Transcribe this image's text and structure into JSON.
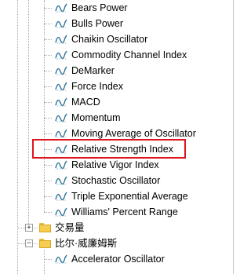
{
  "indicators": [
    "Bears Power",
    "Bulls Power",
    "Chaikin Oscillator",
    "Commodity Channel Index",
    "DeMarker",
    "Force Index",
    "MACD",
    "Momentum",
    "Moving Average of Oscillator",
    "Relative Strength Index",
    "Relative Vigor Index",
    "Stochastic Oscillator",
    "Triple Exponential Average",
    "Williams' Percent Range"
  ],
  "folders": [
    {
      "label": "交易量",
      "expander": "+"
    },
    {
      "label": "比尔·威廉姆斯",
      "expander": "−"
    }
  ],
  "bill_williams_children": [
    "Accelerator Oscillator"
  ],
  "selected_indicator": "Relative Strength Index",
  "colors": {
    "highlight": "#e0141e",
    "icon": "#2a6f97",
    "folder": "#f6cd4c"
  }
}
